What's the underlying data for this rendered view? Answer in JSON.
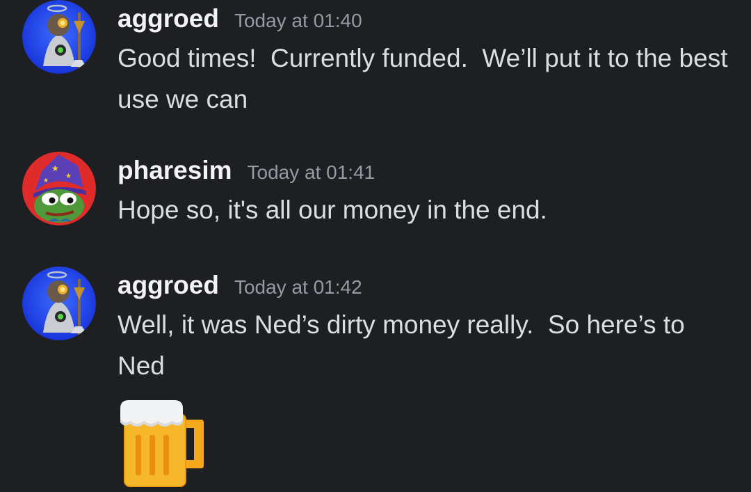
{
  "messages": [
    {
      "username": "aggroed",
      "timestamp": "Today at 01:40",
      "text": "Good times!  Currently funded.  We’ll put it to the best use we can",
      "avatar_icon": "aggroed-avatar",
      "avatar_bg": "#1a3fe0"
    },
    {
      "username": "pharesim",
      "timestamp": "Today at 01:41",
      "text": "Hope so, it's all our money in the end.",
      "avatar_icon": "pepe-wizard-avatar",
      "avatar_bg": "#e02b2b"
    },
    {
      "username": "aggroed",
      "timestamp": "Today at 01:42",
      "text": "Well, it was Ned’s dirty money really.  So here’s to Ned",
      "avatar_icon": "aggroed-avatar",
      "avatar_bg": "#1a3fe0",
      "emoji": "beer-mug-emoji"
    }
  ],
  "colors": {
    "background": "#1e1f23",
    "username": "#f2f3f5",
    "timestamp": "#949ba4",
    "message_text": "#dbdee1"
  }
}
